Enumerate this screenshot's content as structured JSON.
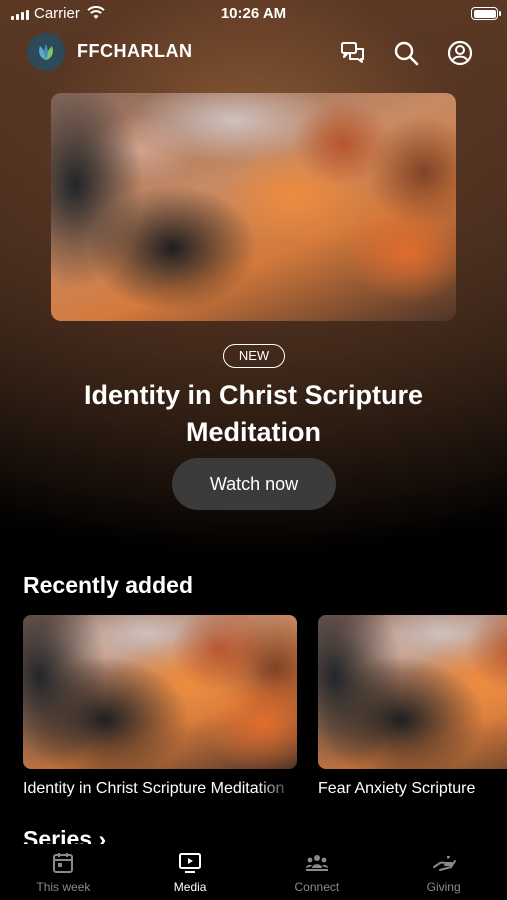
{
  "status_bar": {
    "carrier": "Carrier",
    "time": "10:26 AM"
  },
  "header": {
    "app_name": "FFCHARLAN",
    "icons": [
      "chat-icon",
      "search-icon",
      "profile-icon"
    ]
  },
  "hero": {
    "badge": "NEW",
    "title": "Identity in Christ Scripture Meditation",
    "button_label": "Watch now"
  },
  "recently_added": {
    "heading": "Recently added",
    "items": [
      {
        "title": "Identity in Christ Scripture Meditation"
      },
      {
        "title": "Fear Anxiety Scripture"
      }
    ]
  },
  "series": {
    "heading": "Series"
  },
  "tabs": [
    {
      "label": "This week",
      "icon": "calendar-icon",
      "active": false
    },
    {
      "label": "Media",
      "icon": "play-screen-icon",
      "active": true
    },
    {
      "label": "Connect",
      "icon": "group-icon",
      "active": false
    },
    {
      "label": "Giving",
      "icon": "hand-heart-icon",
      "active": false
    }
  ],
  "colors": {
    "background": "#000000",
    "button": "#3b3b3b",
    "inactive_tab": "#8a8a8a"
  }
}
